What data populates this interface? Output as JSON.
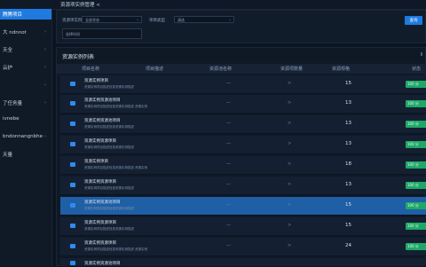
{
  "sidebar": {
    "items": [
      {
        "label": "腾腾项目",
        "has_chevron": false
      },
      {
        "label": "大 ndnnot",
        "has_chevron": true
      },
      {
        "label": "天全",
        "has_chevron": true
      },
      {
        "label": "云护",
        "has_chevron": true
      },
      {
        "label": "",
        "has_chevron": true
      },
      {
        "label": "了任务量",
        "has_chevron": true
      },
      {
        "label": "ivnebe",
        "has_chevron": false
      },
      {
        "label": "bndonnangnbhe",
        "has_chevron": true
      },
      {
        "label": "天量",
        "has_chevron": false
      }
    ]
  },
  "topbar": {
    "breadcrumb": "资源项实例管理 <"
  },
  "filters": {
    "label1": "资源项实例",
    "select1": "全部状态",
    "label2": "项目类型",
    "select2": "清选",
    "select3": "选择时间",
    "query_label": "查询"
  },
  "list": {
    "title": "资源实例列表",
    "action": "Ⅱ",
    "headers": [
      "项目名称",
      "项目描述",
      "资源池名称",
      "资源项数量",
      "资源规格",
      "状态"
    ],
    "rows": [
      {
        "title": "资源实例项目",
        "desc": "资源实例项目描述信息资源实例描述",
        "dash": "—",
        "chevron": ">",
        "num": "15",
        "badge": "100 分",
        "selected": false
      },
      {
        "title": "资源实例资源池项目",
        "desc": "资源实例项目描述信息资源实例描述 资源实例",
        "dash": "—",
        "chevron": ">",
        "num": "13",
        "badge": "100 分",
        "selected": false
      },
      {
        "title": "资源实例资源池项目",
        "desc": "资源实例项目描述信息资源实例描述",
        "dash": "—",
        "chevron": ">",
        "num": "13",
        "badge": "100 分",
        "selected": false
      },
      {
        "title": "资源实例资源项目",
        "desc": "资源实例项目描述信息资源实例描述",
        "dash": "—",
        "chevron": ">",
        "num": "13",
        "badge": "100 分",
        "selected": false
      },
      {
        "title": "资源实例项目",
        "desc": "资源实例项目描述信息资源实例描述 资源实例",
        "dash": "—",
        "chevron": ">",
        "num": "18",
        "badge": "100 分",
        "selected": false
      },
      {
        "title": "资源实例资源项目",
        "desc": "资源实例项目描述信息资源实例描述",
        "dash": "—",
        "chevron": ">",
        "num": "13",
        "badge": "100 分",
        "selected": false
      },
      {
        "title": "资源实例资源池项目",
        "desc": "资源实例项目描述信息资源实例描述",
        "dash": "—",
        "chevron": ">",
        "num": "15",
        "badge": "100 分",
        "selected": true
      },
      {
        "title": "资源实例资源项目",
        "desc": "资源实例项目描述信息资源实例描述",
        "dash": "—",
        "chevron": ">",
        "num": "15",
        "badge": "100 分",
        "selected": false
      },
      {
        "title": "资源实例资源项目",
        "desc": "资源实例项目描述信息资源实例描述 资源实例",
        "dash": "—",
        "chevron": ">",
        "num": "24",
        "badge": "100 分",
        "selected": false
      },
      {
        "title": "资源实例资源池项目",
        "desc": "",
        "dash": "",
        "chevron": "",
        "num": "",
        "badge": "",
        "selected": false
      }
    ]
  },
  "colors": {
    "accent": "#1f7ae0",
    "status_green": "#1ea868",
    "background": "#0b1420"
  }
}
